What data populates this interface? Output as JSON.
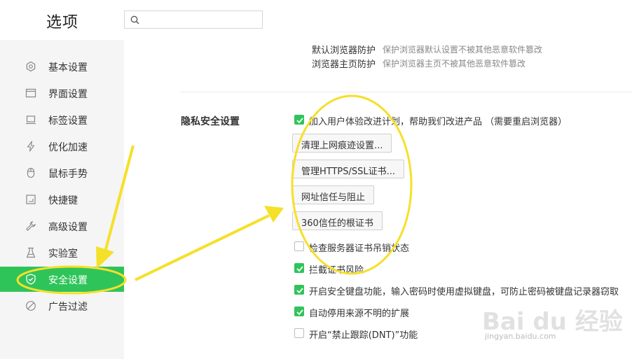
{
  "header": {
    "title": "选项",
    "search_placeholder": ""
  },
  "sidebar": {
    "items": [
      {
        "label": "基本设置",
        "icon": "gear-icon"
      },
      {
        "label": "界面设置",
        "icon": "window-icon"
      },
      {
        "label": "标签设置",
        "icon": "tab-icon"
      },
      {
        "label": "优化加速",
        "icon": "lightning-icon"
      },
      {
        "label": "鼠标手势",
        "icon": "mouse-icon"
      },
      {
        "label": "快捷键",
        "icon": "keyboard-icon"
      },
      {
        "label": "高级设置",
        "icon": "wrench-icon"
      },
      {
        "label": "实验室",
        "icon": "flask-icon"
      },
      {
        "label": "安全设置",
        "icon": "shield-icon",
        "active": true
      },
      {
        "label": "广告过滤",
        "icon": "block-icon"
      }
    ]
  },
  "protection": {
    "default_browser_label": "默认浏览器防护",
    "default_browser_desc": "保护浏览器默认设置不被其他恶意软件篡改",
    "homepage_label": "浏览器主页防护",
    "homepage_desc": "保护浏览器主页不被其他恶意软件篡改"
  },
  "privacy": {
    "section_title": "隐私安全设置",
    "join_program": {
      "label": "加入用户体验改进计划，帮助我们改进产品 （需要重启浏览器）",
      "checked": true
    },
    "buttons": {
      "clear_traces": "清理上网痕迹设置...",
      "manage_https": "管理HTTPS/SSL证书...",
      "url_trust": "网址信任与阻止",
      "root_cert": "360信任的根证书"
    },
    "check_revocation": {
      "label": "检查服务器证书吊销状态",
      "checked": false
    },
    "intercept_cert": {
      "label": "拦截证书风险",
      "checked": true
    },
    "secure_keyboard": {
      "label": "开启安全键盘功能，输入密码时使用虚拟键盘，可防止密码被键盘记录器窃取",
      "checked": true
    },
    "disable_unknown_ext": {
      "label": "自动停用来源不明的扩展",
      "checked": true
    },
    "dnt": {
      "label": "开启“禁止跟踪(DNT)”功能",
      "checked": false
    }
  },
  "watermark": {
    "main": "Bai du 经验",
    "sub": "jingyan.baidu.com"
  },
  "colors": {
    "accent": "#2fc45a",
    "annotation": "#f5e02a"
  }
}
